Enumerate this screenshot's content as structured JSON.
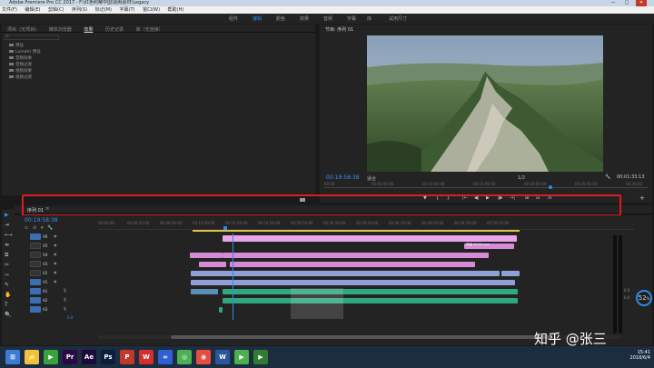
{
  "window": {
    "title": "Adobe Premiere Pro CC 2017 - F:\\红色照耀中国\\视频素材\\Legacy",
    "controls": [
      "—",
      "□",
      "✕"
    ]
  },
  "menu": [
    "文件(F)",
    "编辑(E)",
    "剪辑(C)",
    "序列(S)",
    "标记(M)",
    "字幕(T)",
    "窗口(W)",
    "帮助(H)"
  ],
  "workspaces": [
    {
      "label": "组件",
      "active": false
    },
    {
      "label": "编辑",
      "active": true
    },
    {
      "label": "颜色",
      "active": false
    },
    {
      "label": "效果",
      "active": false
    },
    {
      "label": "音频",
      "active": false
    },
    {
      "label": "字幕",
      "active": false
    },
    {
      "label": "库",
      "active": false
    },
    {
      "label": "试用尺寸",
      "active": false
    }
  ],
  "left_panel": {
    "tabs": [
      {
        "label": "项目: (无项目)",
        "active": false
      },
      {
        "label": "媒体浏览器",
        "active": false
      },
      {
        "label": "效果",
        "active": true
      },
      {
        "label": "历史记录",
        "active": false
      },
      {
        "label": "库（无连接）",
        "active": false
      }
    ],
    "folders": [
      "预设",
      "Lumetri 预设",
      "音频效果",
      "音频过渡",
      "视频效果",
      "视频过渡"
    ]
  },
  "program_monitor": {
    "title": "节目: 序列 01",
    "timecode": "00:19:58:38",
    "fit_label": "适合",
    "scale": "1/2",
    "duration": "00:01:33:13",
    "ruler_labels": [
      "00:00",
      "00:05:00:00",
      "00:10:00:00",
      "00:15:00:00",
      "00:20:00:00",
      "00:25:00:00",
      "00:30:00"
    ],
    "controls": [
      "▼",
      "{",
      "}",
      "|←",
      "◀|",
      "▶",
      "|▶",
      "→|",
      "⊞",
      "⊟",
      "📷"
    ],
    "add_btn": "+"
  },
  "timeline": {
    "sequence_tab": "序列 01",
    "timecode": "00:19:58:38",
    "ruler_labels": [
      "00:00:00",
      "00:04:59:00",
      "00:09:59:00",
      "00:14:59:00",
      "00:19:59:00",
      "00:24:59:00",
      "00:29:59:00",
      "00:34:59:00",
      "00:39:59:00",
      "00:44:59:00",
      "00:49:59:00",
      "00:54:59:00",
      "00:59:59:00"
    ],
    "video_tracks": [
      "V6",
      "V5",
      "V4",
      "V3",
      "V2",
      "V1"
    ],
    "audio_tracks": [
      "A1",
      "A2",
      "A3"
    ],
    "master_label": "0.0",
    "meter_value": "52",
    "meter_unit": "%",
    "meter_labels": [
      "0.0",
      "0.0"
    ],
    "clip_label": "风景 0003.mov",
    "tools": [
      "▶",
      "⇥",
      "⟷",
      "⇹",
      "⧉",
      "✂",
      "⇿",
      "✎",
      "✋",
      "T",
      "🔍"
    ]
  },
  "taskbar": {
    "time": "15:41",
    "date": "2018/6/4",
    "icons": [
      {
        "name": "windows-start-icon",
        "glyph": "⊞",
        "color": "#3b7bd4"
      },
      {
        "name": "folder-icon",
        "glyph": "📁",
        "color": "#f0c040"
      },
      {
        "name": "player-icon",
        "glyph": "▶",
        "color": "#39a33a"
      },
      {
        "name": "premiere-icon",
        "glyph": "Pr",
        "color": "#2a0a46"
      },
      {
        "name": "after-effects-icon",
        "glyph": "Ae",
        "color": "#1c0a3d"
      },
      {
        "name": "photoshop-icon",
        "glyph": "Ps",
        "color": "#0a1f3d"
      },
      {
        "name": "pdf-icon",
        "glyph": "P",
        "color": "#c0392b"
      },
      {
        "name": "weibo-icon",
        "glyph": "W",
        "color": "#d32f2f"
      },
      {
        "name": "baidu-icon",
        "glyph": "∞",
        "color": "#2f5fd3"
      },
      {
        "name": "browser-icon",
        "glyph": "◎",
        "color": "#4caf50"
      },
      {
        "name": "chrome-icon",
        "glyph": "◉",
        "color": "#e74c3c"
      },
      {
        "name": "word-icon",
        "glyph": "W",
        "color": "#2b579a"
      },
      {
        "name": "video-icon",
        "glyph": "▶",
        "color": "#4caf50"
      },
      {
        "name": "player2-icon",
        "glyph": "▶",
        "color": "#2e7d32"
      }
    ]
  },
  "watermark": "知乎 @张三",
  "colors": {
    "accent": "#2d8ceb",
    "highlight_box": "#e01b1b",
    "clip_pink": "#e9a5e9",
    "clip_violet": "#8fa0d6",
    "clip_audio": "#2fa77f"
  }
}
